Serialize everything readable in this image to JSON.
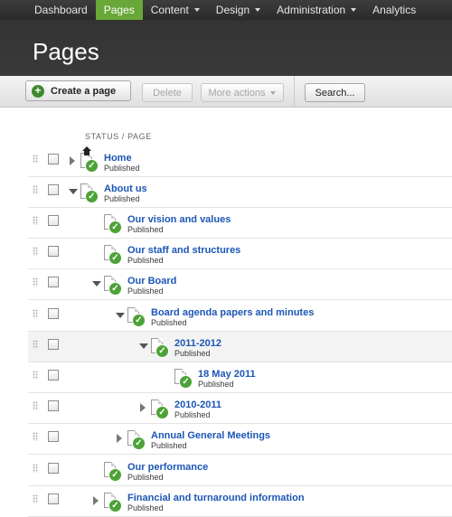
{
  "nav": {
    "items": [
      {
        "label": "Dashboard",
        "active": false,
        "dropdown": false
      },
      {
        "label": "Pages",
        "active": true,
        "dropdown": false
      },
      {
        "label": "Content",
        "active": false,
        "dropdown": true
      },
      {
        "label": "Design",
        "active": false,
        "dropdown": true
      },
      {
        "label": "Administration",
        "active": false,
        "dropdown": true
      },
      {
        "label": "Analytics",
        "active": false,
        "dropdown": false
      }
    ]
  },
  "header": {
    "title": "Pages"
  },
  "toolbar": {
    "create_label": "Create a page",
    "delete_label": "Delete",
    "more_label": "More actions",
    "search_label": "Search..."
  },
  "table": {
    "column_header": "STATUS / PAGE",
    "rows": [
      {
        "title": "Home",
        "status": "Published",
        "depth": 0,
        "expander": "collapsed",
        "home": true
      },
      {
        "title": "About us",
        "status": "Published",
        "depth": 0,
        "expander": "expanded",
        "home": false
      },
      {
        "title": "Our vision and values",
        "status": "Published",
        "depth": 1,
        "expander": "none",
        "home": false
      },
      {
        "title": "Our staff and structures",
        "status": "Published",
        "depth": 1,
        "expander": "none",
        "home": false
      },
      {
        "title": "Our Board",
        "status": "Published",
        "depth": 1,
        "expander": "expanded",
        "home": false
      },
      {
        "title": "Board agenda papers and minutes",
        "status": "Published",
        "depth": 2,
        "expander": "expanded",
        "home": false
      },
      {
        "title": "2011-2012",
        "status": "Published",
        "depth": 3,
        "expander": "expanded",
        "home": false,
        "highlight": true
      },
      {
        "title": "18 May 2011",
        "status": "Published",
        "depth": 4,
        "expander": "none",
        "home": false
      },
      {
        "title": "2010-2011",
        "status": "Published",
        "depth": 3,
        "expander": "collapsed",
        "home": false
      },
      {
        "title": "Annual General Meetings",
        "status": "Published",
        "depth": 2,
        "expander": "collapsed",
        "home": false
      },
      {
        "title": "Our performance",
        "status": "Published",
        "depth": 1,
        "expander": "none",
        "home": false
      },
      {
        "title": "Financial and turnaround information",
        "status": "Published",
        "depth": 1,
        "expander": "collapsed",
        "home": false
      }
    ]
  },
  "colors": {
    "nav_active": "#69a739",
    "link": "#1b56b5",
    "published_check": "#4da237"
  }
}
